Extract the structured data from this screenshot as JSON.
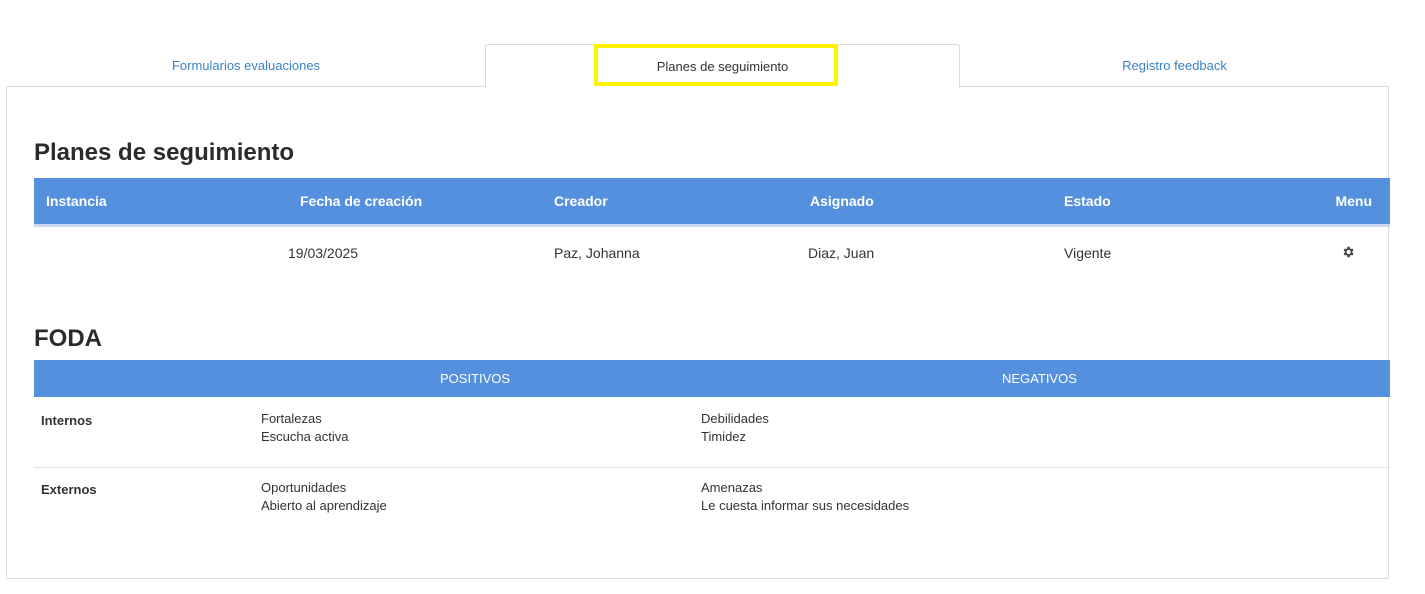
{
  "tabs": [
    {
      "label": "Formularios evaluaciones",
      "active": false
    },
    {
      "label": "Planes de seguimiento",
      "active": true
    },
    {
      "label": "Registro feedback",
      "active": false
    }
  ],
  "plans": {
    "title": "Planes de seguimiento",
    "columns": [
      "Instancia",
      "Fecha de creación",
      "Creador",
      "Asignado",
      "Estado",
      "Menu"
    ],
    "rows": [
      {
        "instancia": "",
        "fecha": "19/03/2025",
        "creador": "Paz, Johanna",
        "asignado": "Diaz, Juan",
        "estado": "Vigente",
        "menu_icon": "gear-icon"
      }
    ]
  },
  "foda": {
    "title": "FODA",
    "columns": [
      "POSITIVOS",
      "NEGATIVOS"
    ],
    "rows": [
      {
        "label": "Internos",
        "positive_title": "Fortalezas",
        "positive_value": "Escucha activa",
        "negative_title": "Debilidades",
        "negative_value": "Timidez"
      },
      {
        "label": "Externos",
        "positive_title": "Oportunidades",
        "positive_value": "Abierto al aprendizaje",
        "negative_title": "Amenazas",
        "negative_value": "Le cuesta informar sus necesidades"
      }
    ]
  },
  "colors": {
    "header_blue": "#5490de",
    "link_blue": "#3b82c4",
    "highlight_yellow": "#fff200"
  }
}
